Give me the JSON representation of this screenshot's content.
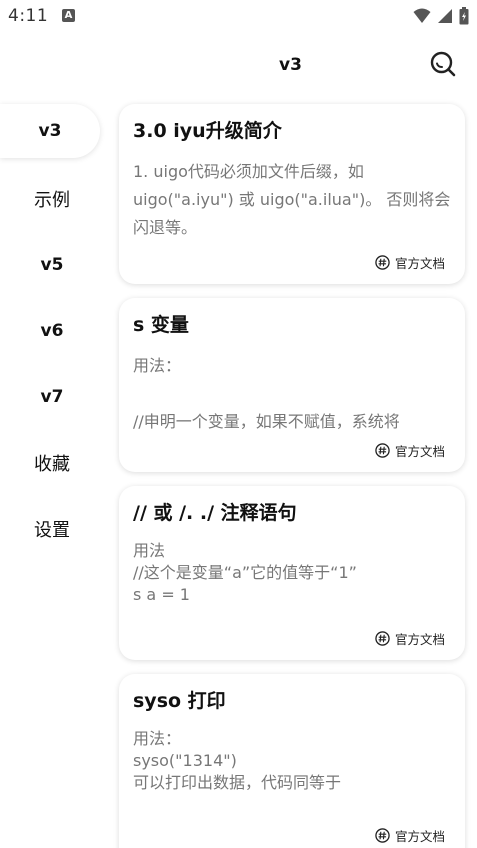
{
  "status": {
    "time": "4:11",
    "indicator": "A"
  },
  "app_bar": {
    "title": "v3",
    "search_icon": "search-icon"
  },
  "sidebar": {
    "items": [
      {
        "label": "v3",
        "active": true
      },
      {
        "label": "示例"
      },
      {
        "label": "v5"
      },
      {
        "label": "v6"
      },
      {
        "label": "v7"
      },
      {
        "label": "收藏"
      },
      {
        "label": "设置"
      }
    ]
  },
  "cards": [
    {
      "title": "3.0 iyu升级简介",
      "body": "1. uigo代码必须加文件后缀，如 uigo(\"a.iyu\") 或 uigo(\"a.ilua\")。 否则将会闪退等。",
      "footer": "官方文档"
    },
    {
      "title": "s 变量",
      "body": "用法：\n\n//申明一个变量，如果不赋值，系统将",
      "footer": "官方文档"
    },
    {
      "title": "// 或 /. ./ 注释语句",
      "body": "用法\n//这个是变量“a”它的值等于“1”\ns a = 1",
      "footer": "官方文档"
    },
    {
      "title": "syso 打印",
      "body": "用法：\nsyso(\"1314\")\n可以打印出数据，代码同等于",
      "footer": "官方文档"
    }
  ]
}
